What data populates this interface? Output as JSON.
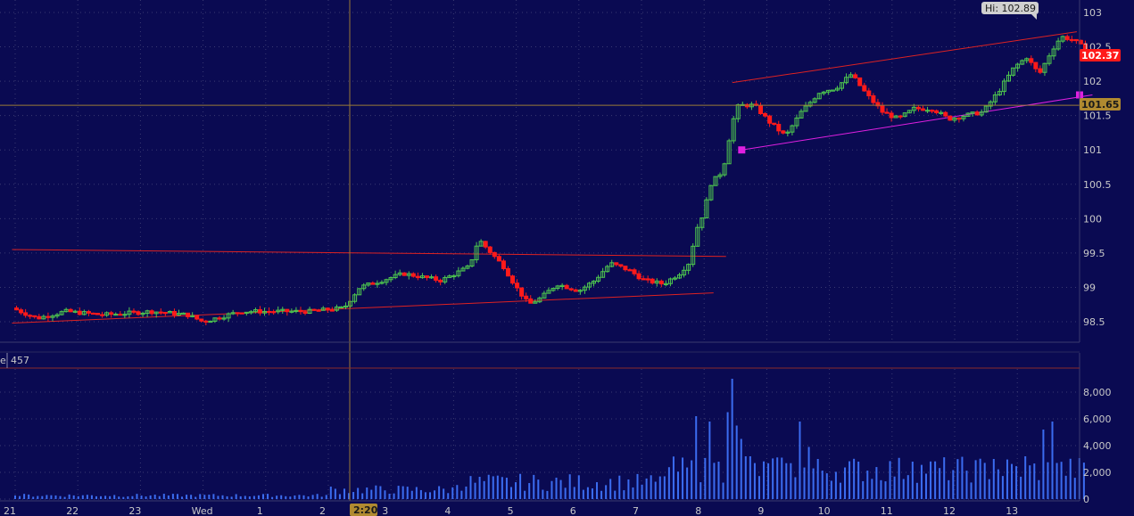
{
  "colors": {
    "background": "#0a0a52",
    "grid": "#3a3a72",
    "up": "#4ec84e",
    "down": "#ff1a1a",
    "volume": "#3b6cf0",
    "crosshair": "#9a7a36",
    "trend_red": "#dd2222",
    "trend_magenta": "#e020e0",
    "last_price_bg": "#ff1a1a",
    "crosshair_tag_bg": "#b08a30",
    "hi_bg": "#d0d0d0"
  },
  "volume_panel": {
    "label_fragment": "e",
    "value": "457"
  },
  "crosshair": {
    "price_label": "101.65",
    "time_label": "2:20"
  },
  "chart_data": [
    {
      "type": "candlestick",
      "x_tick_labels": [
        "21",
        "22",
        "23",
        "Wed",
        "1",
        "2",
        "3",
        "4",
        "5",
        "6",
        "7",
        "8",
        "9",
        "10",
        "11",
        "12",
        "13"
      ],
      "y_tick_labels": [
        "98.5",
        "99",
        "99.5",
        "100",
        "100.5",
        "101",
        "101.5",
        "102",
        "102.5",
        "103"
      ],
      "ylim": [
        98.3,
        103.1
      ],
      "last_price": "102.37",
      "high_label": "Hi: 102.89",
      "price_path": [
        [
          -0.05,
          98.7
        ],
        [
          0.35,
          98.55
        ],
        [
          0.8,
          98.65
        ],
        [
          1.4,
          98.6
        ],
        [
          2.2,
          98.65
        ],
        [
          2.75,
          98.6
        ],
        [
          3.0,
          98.5
        ],
        [
          3.6,
          98.65
        ],
        [
          4.3,
          98.65
        ],
        [
          4.7,
          98.65
        ],
        [
          5.25,
          98.7
        ],
        [
          5.5,
          99.0
        ],
        [
          5.85,
          99.1
        ],
        [
          6.2,
          99.2
        ],
        [
          6.8,
          99.1
        ],
        [
          7.25,
          99.3
        ],
        [
          7.4,
          99.7
        ],
        [
          7.6,
          99.5
        ],
        [
          7.8,
          99.3
        ],
        [
          8.0,
          99.0
        ],
        [
          8.2,
          98.75
        ],
        [
          8.4,
          98.85
        ],
        [
          8.65,
          99.05
        ],
        [
          9.0,
          98.95
        ],
        [
          9.25,
          99.1
        ],
        [
          9.5,
          99.35
        ],
        [
          9.8,
          99.25
        ],
        [
          10.05,
          99.1
        ],
        [
          10.35,
          99.05
        ],
        [
          10.6,
          99.2
        ],
        [
          10.75,
          99.35
        ],
        [
          10.9,
          99.9
        ],
        [
          11.0,
          100.1
        ],
        [
          11.1,
          100.5
        ],
        [
          11.3,
          100.7
        ],
        [
          11.45,
          101.4
        ],
        [
          11.55,
          101.65
        ],
        [
          11.8,
          101.65
        ],
        [
          12.05,
          101.4
        ],
        [
          12.3,
          101.2
        ],
        [
          12.55,
          101.55
        ],
        [
          12.85,
          101.85
        ],
        [
          13.1,
          101.9
        ],
        [
          13.35,
          102.1
        ],
        [
          13.6,
          101.8
        ],
        [
          13.85,
          101.55
        ],
        [
          14.1,
          101.45
        ],
        [
          14.35,
          101.6
        ],
        [
          14.65,
          101.6
        ],
        [
          14.9,
          101.45
        ],
        [
          15.15,
          101.5
        ],
        [
          15.45,
          101.55
        ],
        [
          15.7,
          101.85
        ],
        [
          15.95,
          102.2
        ],
        [
          16.15,
          102.35
        ],
        [
          16.35,
          102.1
        ],
        [
          16.55,
          102.45
        ],
        [
          16.7,
          102.65
        ],
        [
          16.9,
          102.6
        ],
        [
          17.1,
          102.45
        ]
      ],
      "trend_lines": [
        {
          "color": "red",
          "from": [
            -0.05,
            99.55
          ],
          "to": [
            11.35,
            99.45
          ]
        },
        {
          "color": "red",
          "from": [
            -0.05,
            98.48
          ],
          "to": [
            11.15,
            98.92
          ]
        },
        {
          "color": "red",
          "from": [
            11.45,
            101.98
          ],
          "to": [
            16.95,
            102.72
          ]
        },
        {
          "color": "magenta",
          "from": [
            11.6,
            101.0
          ],
          "to": [
            17.2,
            101.8
          ]
        }
      ]
    },
    {
      "type": "bar",
      "name": "volume",
      "y_tick_labels": [
        "0",
        "2,000",
        "4,000",
        "6,000",
        "8,000"
      ],
      "ylim": [
        0,
        9500
      ],
      "peaks": [
        [
          10.8,
          2500
        ],
        [
          10.85,
          6200
        ],
        [
          11.0,
          2700
        ],
        [
          11.1,
          5800
        ],
        [
          11.2,
          2800
        ],
        [
          11.4,
          6500
        ],
        [
          11.45,
          9000
        ],
        [
          11.5,
          5500
        ],
        [
          11.6,
          4500
        ],
        [
          11.7,
          3200
        ],
        [
          12.25,
          3100
        ],
        [
          12.5,
          5800
        ],
        [
          12.65,
          3900
        ],
        [
          12.85,
          3000
        ],
        [
          13.3,
          2800
        ],
        [
          13.45,
          2600
        ],
        [
          14.35,
          2800
        ],
        [
          14.55,
          1900
        ],
        [
          15.05,
          1700
        ],
        [
          15.35,
          2500
        ],
        [
          15.6,
          3000
        ],
        [
          15.85,
          2800
        ],
        [
          16.0,
          2200
        ],
        [
          16.15,
          3200
        ],
        [
          16.4,
          5200
        ],
        [
          16.55,
          5800
        ],
        [
          16.65,
          2700
        ]
      ]
    }
  ]
}
